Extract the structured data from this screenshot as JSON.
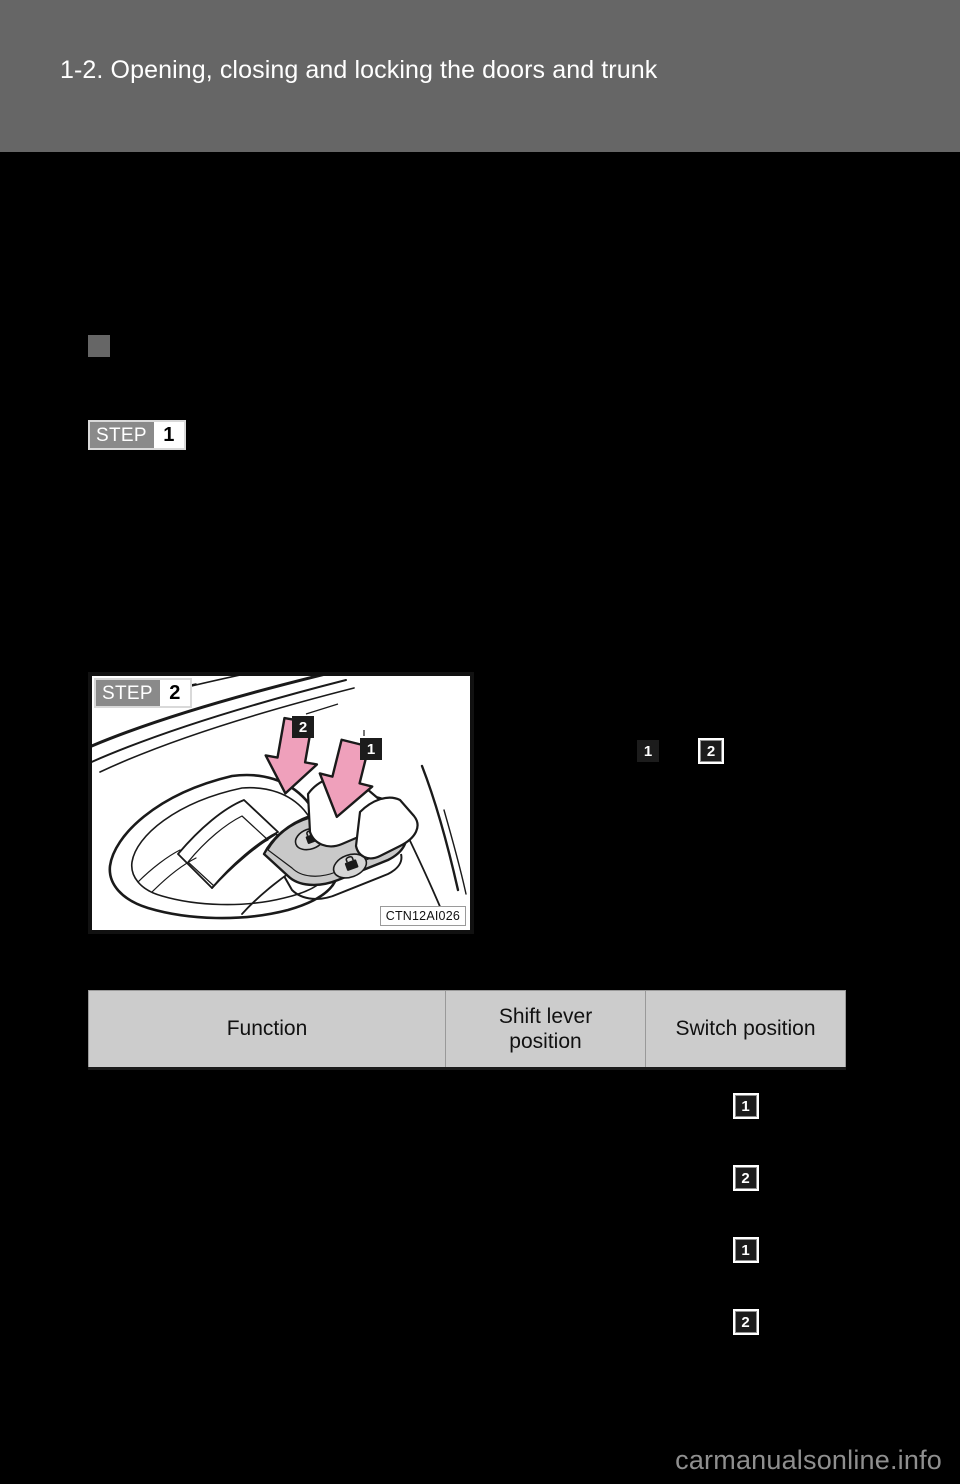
{
  "header": {
    "title": "1-2. Opening, closing and locking the doors and trunk"
  },
  "section": {
    "bullet_icon": "square-bullet-icon",
    "heading": ""
  },
  "steps": [
    {
      "word": "STEP",
      "number": "1",
      "body": ""
    },
    {
      "word": "STEP",
      "number": "2",
      "body": ""
    }
  ],
  "illustration": {
    "caption": "CTN12AI026",
    "alt": "door-lock-switch-illustration",
    "callouts": [
      {
        "number": "1",
        "name": "callout-unlock-arrow"
      },
      {
        "number": "2",
        "name": "callout-lock-arrow"
      }
    ],
    "arrow_color": "#efa0bb",
    "switch_color": "#c9c9c9"
  },
  "inline_callouts": [
    {
      "number": "1",
      "outlined": false
    },
    {
      "number": "2",
      "outlined": true
    }
  ],
  "side_text": "",
  "table": {
    "columns": [
      "Function",
      "Shift lever\nposition",
      "Switch position"
    ],
    "headers": {
      "function": "Function",
      "shift_lever_position_line1": "Shift lever",
      "shift_lever_position_line2": "position",
      "switch_position": "Switch position"
    },
    "rows": [
      {
        "function": "",
        "shift_lever_position": "",
        "switch_position": "1",
        "switch_outlined": true
      },
      {
        "function": "",
        "shift_lever_position": "",
        "switch_position": "2",
        "switch_outlined": true
      },
      {
        "function": "",
        "shift_lever_position": "",
        "switch_position": "1",
        "switch_outlined": true
      },
      {
        "function": "",
        "shift_lever_position": "",
        "switch_position": "2",
        "switch_outlined": true
      }
    ]
  },
  "footer": {
    "watermark": "carmanualsonline.info"
  },
  "colors": {
    "header_band": "#666666",
    "page_background": "#000000",
    "table_header": "#cccccc",
    "badge_dark": "#1c1c1c",
    "step_gray": "#8a8a8a",
    "watermark": "#8f8f8f",
    "arrow_pink": "#efa0bb"
  }
}
